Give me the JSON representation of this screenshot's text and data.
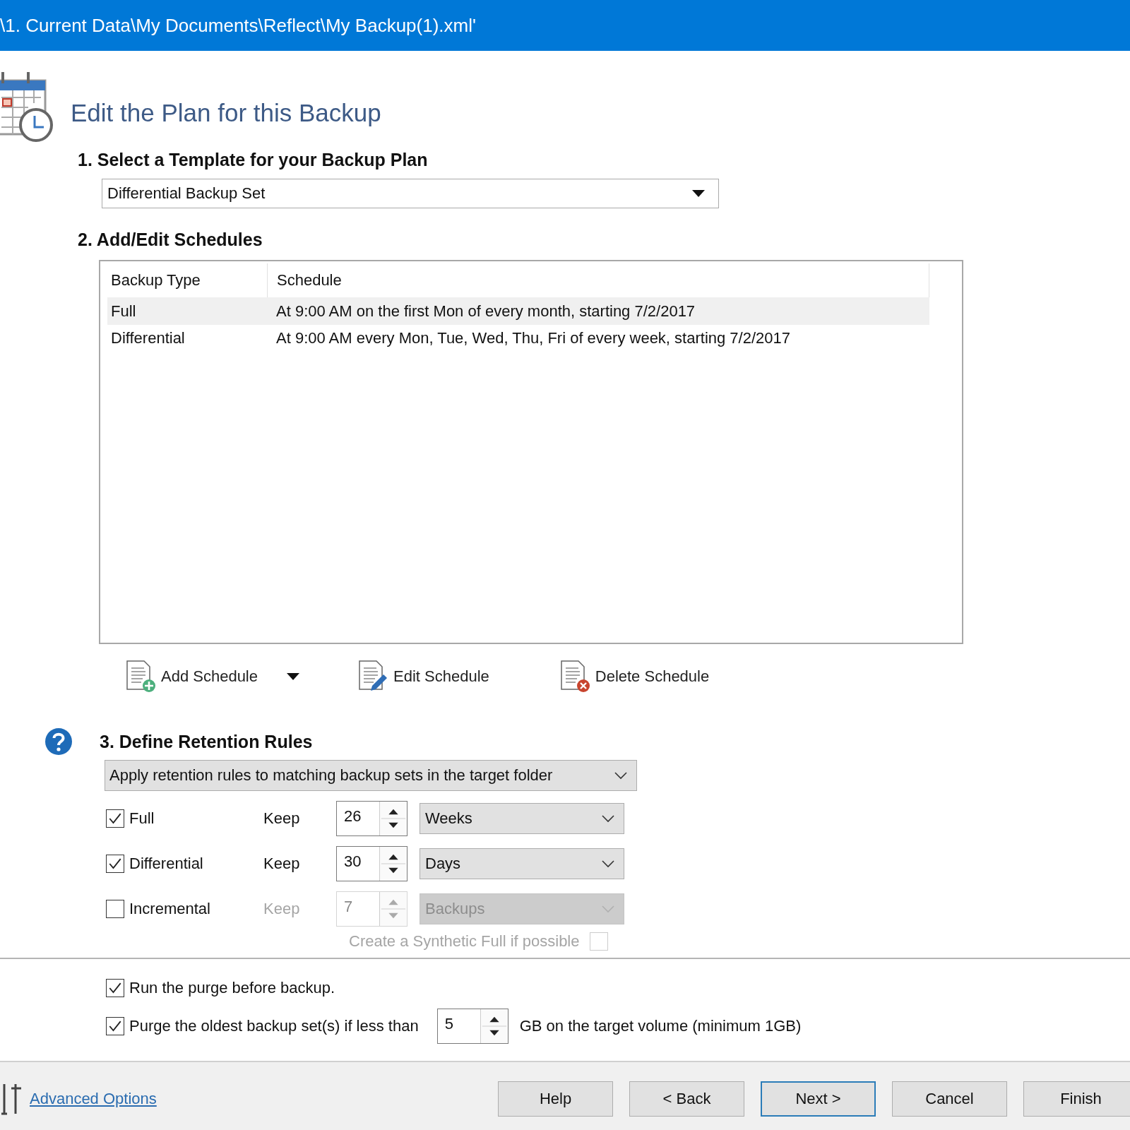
{
  "title_bar": {
    "title": "\\1. Current Data\\My Documents\\Reflect\\My Backup(1).xml'"
  },
  "heading": "Edit the Plan for this Backup",
  "template_section": {
    "label": "1. Select a Template for your Backup Plan",
    "value": "Differential Backup Set"
  },
  "schedules_section": {
    "label": "2. Add/Edit Schedules",
    "columns": [
      "Backup Type",
      "Schedule"
    ],
    "rows": [
      {
        "backup_type": "Full",
        "schedule": "At 9:00 AM on the first Mon of every month, starting 7/2/2017",
        "selected": true
      },
      {
        "backup_type": "Differential",
        "schedule": "At 9:00 AM every Mon, Tue, Wed, Thu, Fri of every week, starting 7/2/2017",
        "selected": false
      }
    ]
  },
  "schedule_actions": [
    {
      "kind": "add",
      "label": "Add Schedule",
      "has_menu": true
    },
    {
      "kind": "edit",
      "label": "Edit Schedule",
      "has_menu": false
    },
    {
      "kind": "delete",
      "label": "Delete Schedule",
      "has_menu": false
    }
  ],
  "retention_section": {
    "label": "3. Define Retention Rules",
    "mode": "Apply retention rules to matching backup sets in the target folder",
    "rules": [
      {
        "label": "Full",
        "checked": true,
        "disabled": false,
        "keep_label": "Keep",
        "count": "26",
        "unit": "Weeks"
      },
      {
        "label": "Differential",
        "checked": true,
        "disabled": false,
        "keep_label": "Keep",
        "count": "30",
        "unit": "Days"
      },
      {
        "label": "Incremental",
        "checked": false,
        "disabled": true,
        "keep_label": "Keep",
        "count": "7",
        "unit": "Backups"
      }
    ],
    "synthetic_full": {
      "label": "Create a Synthetic Full if possible",
      "checked": false,
      "disabled": true
    }
  },
  "purge_options": [
    {
      "kind": "checkbox",
      "label": "Run the purge before backup.",
      "checked": true
    },
    {
      "kind": "threshold",
      "label": "Purge the oldest backup set(s) if less than",
      "checked": true,
      "value": "5",
      "suffix": "GB on the target volume (minimum 1GB)"
    }
  ],
  "footer": {
    "advanced_link": "Advanced Options",
    "buttons": [
      {
        "label": "Help",
        "default": false
      },
      {
        "label": "< Back",
        "default": false
      },
      {
        "label": "Next >",
        "default": true
      },
      {
        "label": "Cancel",
        "default": false
      },
      {
        "label": "Finish",
        "default": false
      }
    ]
  }
}
